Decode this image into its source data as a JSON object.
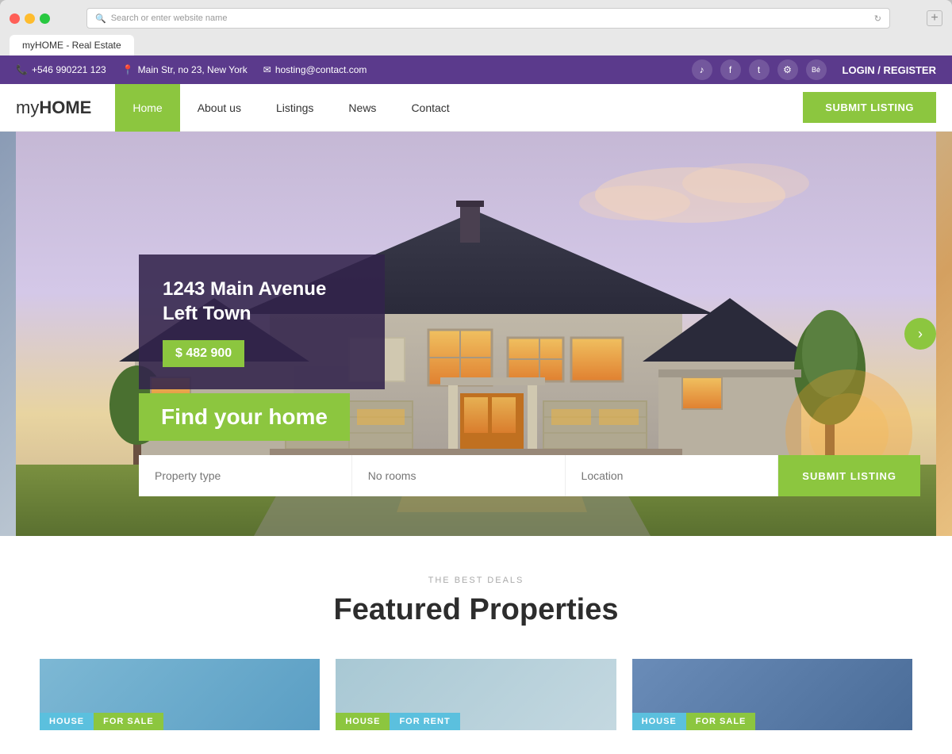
{
  "browser": {
    "address": "Search or enter website name",
    "tab_label": "myHOME - Real Estate"
  },
  "topbar": {
    "phone": "+546 990221 123",
    "address": "Main Str, no 23, New York",
    "email": "hosting@contact.com",
    "login": "LOGIN / REGISTER",
    "social": [
      "spotify-icon",
      "facebook-icon",
      "twitter-icon",
      "settings-icon",
      "behance-icon"
    ]
  },
  "nav": {
    "logo_prefix": "my",
    "logo_suffix": "HOME",
    "links": [
      {
        "label": "Home",
        "active": true
      },
      {
        "label": "About us",
        "active": false
      },
      {
        "label": "Listings",
        "active": false
      },
      {
        "label": "News",
        "active": false
      },
      {
        "label": "Contact",
        "active": false
      }
    ],
    "submit_label": "SUBMIT LISTING"
  },
  "hero": {
    "property_address": "1243 Main Avenue Left Town",
    "property_price": "$ 482 900",
    "find_home_text": "Find your home",
    "search": {
      "property_type_placeholder": "Property type",
      "no_rooms_placeholder": "No rooms",
      "location_placeholder": "Location",
      "submit_label": "SUBMIT LISTING"
    },
    "nav_arrow": "›"
  },
  "featured": {
    "subtitle": "THE BEST DEALS",
    "title": "Featured Properties",
    "cards": [
      {
        "type_badge": "HOUSE",
        "status_badge": "FOR SALE",
        "type_color": "#5bc0de",
        "status_color": "#8cc63f"
      },
      {
        "type_badge": "HOUSE",
        "status_badge": "FOR RENT",
        "type_color": "#8cc63f",
        "status_color": "#5bc0de"
      },
      {
        "type_badge": "HOUSE",
        "status_badge": "FOR SALE",
        "type_color": "#5bc0de",
        "status_color": "#8cc63f"
      }
    ]
  },
  "social_icons": {
    "spotify": "♪",
    "facebook": "f",
    "twitter": "t",
    "settings": "⚙",
    "behance": "Bé"
  }
}
